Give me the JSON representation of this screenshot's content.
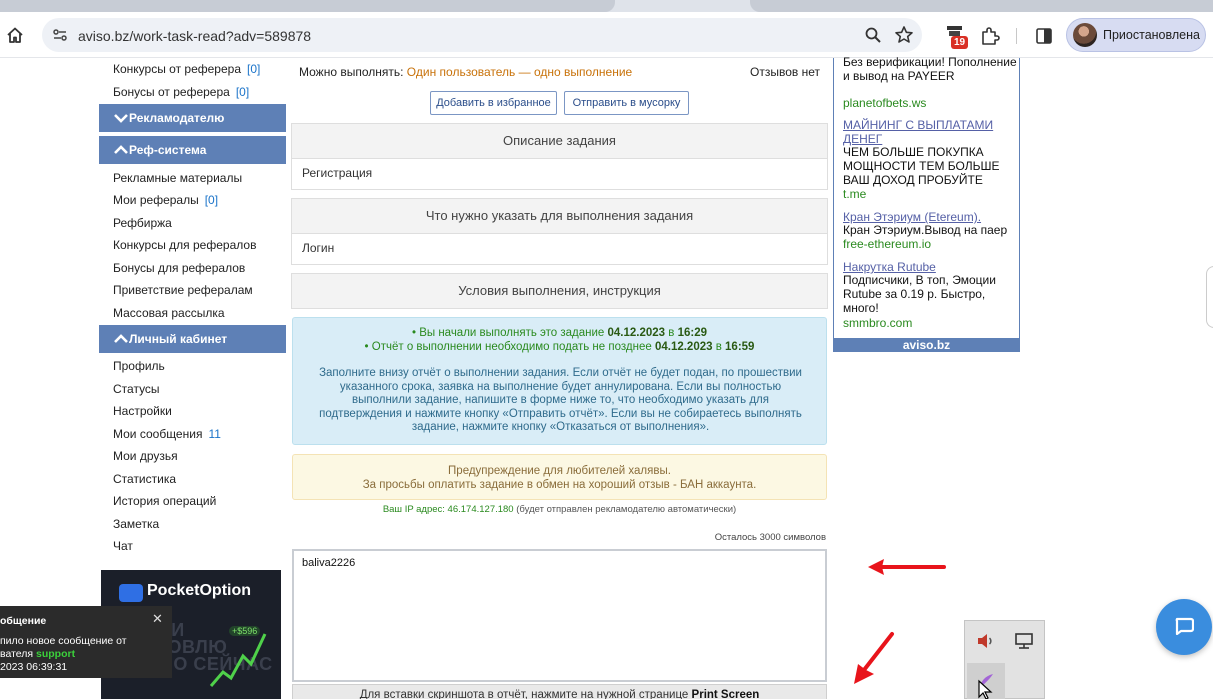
{
  "browser": {
    "url": "aviso.bz/work-task-read?adv=589878",
    "extension_badge": "19",
    "profile_label": "Приостановлена"
  },
  "sidebar": {
    "top_items": [
      {
        "label": "Конкурсы от реферера",
        "count": "[0]"
      },
      {
        "label": "Бонусы от реферера",
        "count": "[0]"
      }
    ],
    "sections": [
      {
        "title": "Рекламодателю",
        "expanded": false
      },
      {
        "title": "Реф-система",
        "expanded": true
      },
      {
        "title": "Личный кабинет",
        "expanded": true
      }
    ],
    "ref_items": [
      {
        "label": "Рекламные материалы",
        "count": ""
      },
      {
        "label": "Мои рефералы",
        "count": "[0]"
      },
      {
        "label": "Рефбиржа",
        "count": ""
      },
      {
        "label": "Конкурсы для рефералов",
        "count": ""
      },
      {
        "label": "Бонусы для рефералов",
        "count": ""
      },
      {
        "label": "Приветствие рефералам",
        "count": ""
      },
      {
        "label": "Массовая рассылка",
        "count": ""
      }
    ],
    "cabinet_items": [
      {
        "label": "Профиль",
        "count": ""
      },
      {
        "label": "Статусы",
        "count": ""
      },
      {
        "label": "Настройки",
        "count": ""
      },
      {
        "label": "Мои сообщения",
        "count": "11"
      },
      {
        "label": "Мои друзья",
        "count": ""
      },
      {
        "label": "Статистика",
        "count": ""
      },
      {
        "label": "История операций",
        "count": ""
      },
      {
        "label": "Заметка",
        "count": ""
      },
      {
        "label": "Чат",
        "count": ""
      }
    ],
    "promo": {
      "brand": "PocketOption",
      "slogan": "НАЧНИ ТОРГОВЛЮ ПРЯМО СЕЙЧАС",
      "badge": "+$596"
    }
  },
  "toast": {
    "title": "общение",
    "line1": "пило новое сообщение от",
    "line2_prefix": "вателя",
    "user": "support",
    "time": "2023 06:39:31",
    "close": "✕"
  },
  "task": {
    "can_do_label": "Можно выполнять:",
    "can_do_value": "Один пользователь — одно выполнение",
    "reviews": "Отзывов нет",
    "btn_favorite": "Добавить в избранное",
    "btn_trash": "Отправить в мусорку",
    "desc_title": "Описание задания",
    "desc_body": "Регистрация",
    "need_title": "Что нужно указать для выполнения задания",
    "need_body": "Логин",
    "cond_title": "Условия выполнения, инструкция"
  },
  "info": {
    "start_prefix": "• Вы начали выполнять это задание",
    "start_date": "04.12.2023",
    "start_in": "в",
    "start_time": "16:29",
    "deadline_prefix": "• Отчёт о выполнении необходимо подать не позднее",
    "deadline_date": "04.12.2023",
    "deadline_in": "в",
    "deadline_time": "16:59",
    "paragraph": "Заполните внизу отчёт о выполнении задания. Если отчёт не будет подан, по прошествии указанного срока, заявка на выполнение будет аннулирована. Если вы полностью выполнили задание, напишите в форме ниже то, что необходимо указать для подтверждения и нажмите кнопку «Отправить отчёт». Если вы не собираетесь выполнять задание, нажмите кнопку «Отказаться от выполнения»."
  },
  "warning": {
    "line1": "Предупреждение для любителей халявы.",
    "line2": "За просьбы оплатить задание в обмен на хороший отзыв - БАН аккаунта."
  },
  "ip": {
    "label": "Ваш IP адрес: 46.174.127.180",
    "note": "(будет отправлен рекламодателю автоматически)"
  },
  "report": {
    "remaining": "Осталось 3000 символов",
    "value": "baliva2226",
    "hint_prefix": "Для вставки скриншота в отчёт, нажмите на нужной странице",
    "hint_key": "Print Screen"
  },
  "ads": {
    "block1": {
      "text": "Без верификации! Пополнение и вывод на PAYEER",
      "url": "planetofbets.ws"
    },
    "block2": {
      "title": "МАЙНИНГ С ВЫПЛАТАМИ ДЕНЕГ",
      "text": "ЧЕМ БОЛЬШЕ ПОКУПКА МОЩНОСТИ ТЕМ БОЛЬШЕ ВАШ ДОХОД ПРОБУЙТЕ",
      "url": "t.me"
    },
    "block3": {
      "title": "Кран Этэриум (Etereum).",
      "text": "Кран Этэриум.Вывод на паер",
      "url": "free-ethereum.io"
    },
    "block4": {
      "title": "Накрутка Rutube",
      "text": "Подписчики, В топ, Эмоции Rutube за 0.19 р. Быстро, много!",
      "url": "smmbro.com"
    },
    "footer": "aviso.bz"
  },
  "colors": {
    "nav_header": "#5e80b6",
    "info_bg": "#d9edf7",
    "warn_bg": "#fcf8e3",
    "annotation_arrow": "#e8141b"
  }
}
